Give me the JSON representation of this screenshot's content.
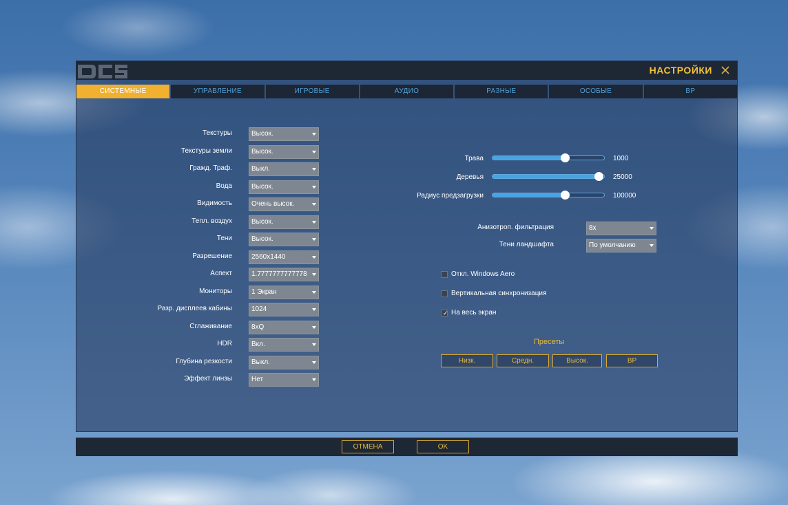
{
  "window": {
    "title": "НАСТРОЙКИ",
    "logo": "DCS"
  },
  "tabs": [
    {
      "label": "СИСТЕМНЫЕ",
      "active": true
    },
    {
      "label": "УПРАВЛЕНИЕ",
      "active": false
    },
    {
      "label": "ИГРОВЫЕ",
      "active": false
    },
    {
      "label": "АУДИО",
      "active": false
    },
    {
      "label": "РАЗНЫЕ",
      "active": false
    },
    {
      "label": "ОСОБЫЕ",
      "active": false
    },
    {
      "label": "ВР",
      "active": false
    }
  ],
  "settings": [
    {
      "label": "Текстуры",
      "value": "Высок."
    },
    {
      "label": "Текстуры земли",
      "value": "Высок."
    },
    {
      "label": "Гражд. Траф.",
      "value": "Выкл."
    },
    {
      "label": "Вода",
      "value": "Высок."
    },
    {
      "label": "Видимость",
      "value": "Очень высок."
    },
    {
      "label": "Тепл. воздух",
      "value": "Высок."
    },
    {
      "label": "Тени",
      "value": "Высок."
    },
    {
      "label": "Разрешение",
      "value": "2560x1440"
    },
    {
      "label": "Аспект",
      "value": "1.7777777777778"
    },
    {
      "label": "Мониторы",
      "value": "1 Экран"
    },
    {
      "label": "Разр. дисплеев кабины",
      "value": "1024"
    },
    {
      "label": "Сглаживание",
      "value": "8xQ"
    },
    {
      "label": "HDR",
      "value": "Вкл."
    },
    {
      "label": "Глубина резкости",
      "value": "Выкл."
    },
    {
      "label": "Эффект линзы",
      "value": "Нет"
    }
  ],
  "sliders": [
    {
      "label": "Трава",
      "value": "1000",
      "fraction": 0.65
    },
    {
      "label": "Деревья",
      "value": "25000",
      "fraction": 0.95
    },
    {
      "label": "Радиус предзагрузки",
      "value": "100000",
      "fraction": 0.65
    }
  ],
  "right_selects": [
    {
      "label": "Анизотроп. фильтрация",
      "value": "8x"
    },
    {
      "label": "Тени ландшафта",
      "value": "По умолчанию"
    }
  ],
  "checkboxes": [
    {
      "label": "Откл. Windows Aero",
      "checked": false
    },
    {
      "label": "Вертикальная синхронизация",
      "checked": false
    },
    {
      "label": "На весь экран",
      "checked": true
    }
  ],
  "presets": {
    "title": "Пресеты",
    "buttons": [
      "Низк.",
      "Средн.",
      "Высок.",
      "ВР"
    ]
  },
  "footer": {
    "cancel_label": "ОТМЕНА",
    "ok_label": "OK"
  },
  "colors": {
    "accent": "#f0b130",
    "tab_text": "#4ea0d8",
    "slider": "#4aa3e3"
  }
}
